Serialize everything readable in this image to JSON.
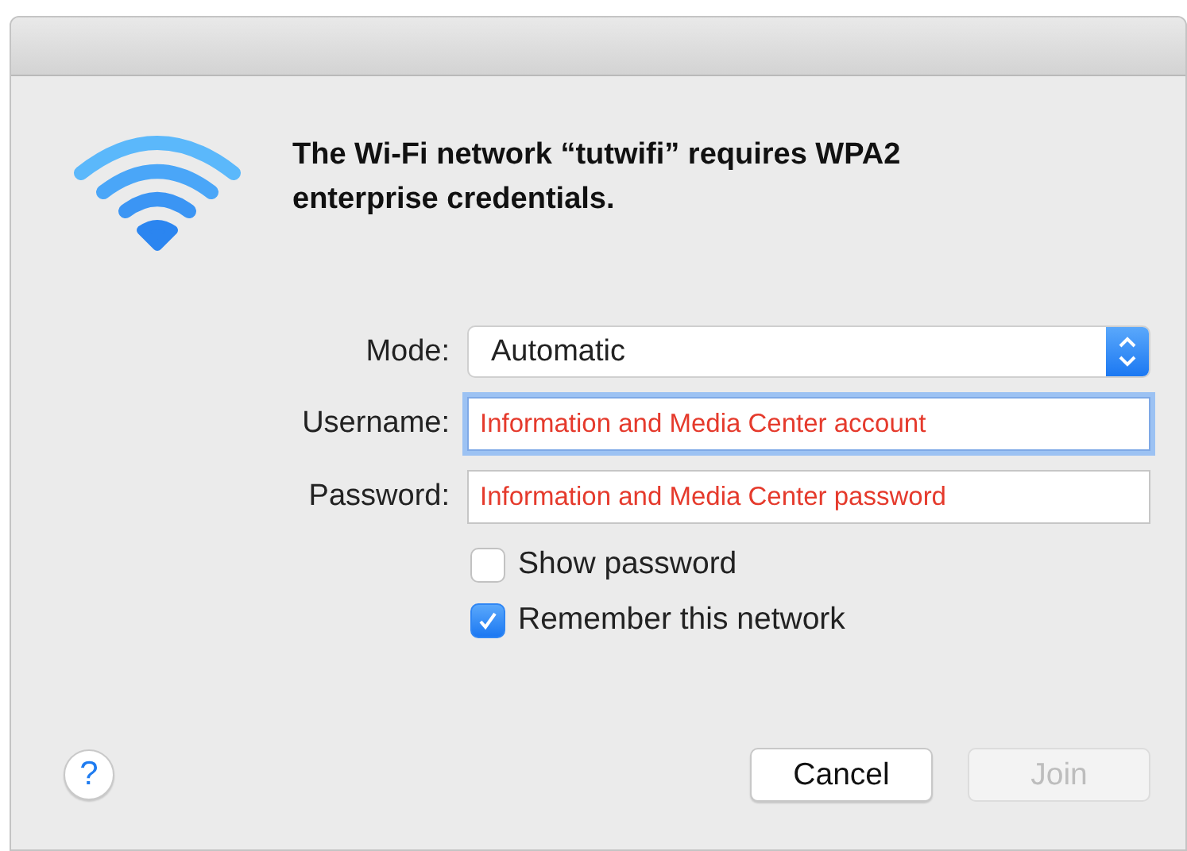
{
  "heading": "The Wi-Fi network “tutwifi” requires WPA2 enterprise credentials.",
  "fields": [
    {
      "kind": "select",
      "label": "Mode:",
      "value": "Automatic"
    },
    {
      "kind": "text",
      "label": "Username:",
      "value": "Information and Media Center account",
      "focused": true
    },
    {
      "kind": "text",
      "label": "Password:",
      "value": "Information and Media Center password",
      "focused": false
    }
  ],
  "options": [
    {
      "label": "Show password",
      "checked": false
    },
    {
      "label": "Remember this network",
      "checked": true
    }
  ],
  "help": "?",
  "buttons": [
    {
      "label": "Cancel",
      "disabled": false
    },
    {
      "label": "Join",
      "disabled": true
    }
  ]
}
